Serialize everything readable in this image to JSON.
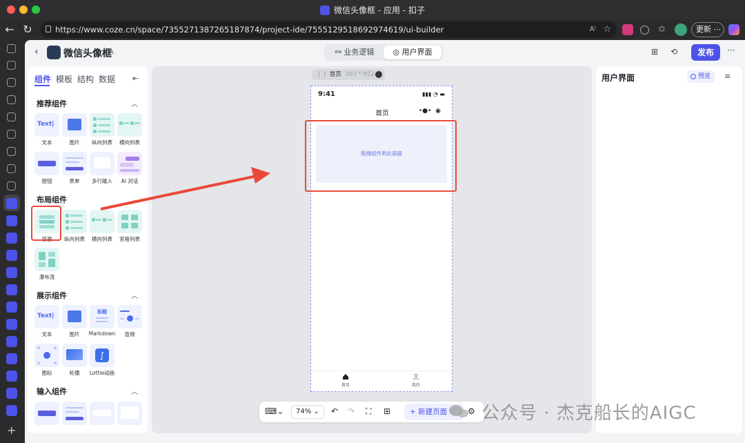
{
  "window": {
    "title": "微信头像框 - 应用 - 扣子"
  },
  "browser": {
    "url": "https://www.coze.cn/space/7355271387265187874/project-ide/7555129518692974619/ui-builder",
    "update_label": "更新"
  },
  "header": {
    "app_name": "微信头像框",
    "tabs": [
      {
        "label": "业务逻辑",
        "icon": "workflow-icon",
        "active": false
      },
      {
        "label": "用户界面",
        "icon": "palette-icon",
        "active": true
      }
    ],
    "publish_label": "发布"
  },
  "left_panel": {
    "tabs": [
      "组件",
      "模板",
      "结构",
      "数据"
    ],
    "active_tab": "组件",
    "sections": [
      {
        "title": "推荐组件",
        "items": [
          {
            "label": "文本",
            "tile_text": "Text|"
          },
          {
            "label": "图片"
          },
          {
            "label": "纵向列表"
          },
          {
            "label": "横向列表"
          },
          {
            "label": "按钮",
            "tile_text": "Button"
          },
          {
            "label": "表单"
          },
          {
            "label": "多行输入"
          },
          {
            "label": "AI 对话"
          }
        ]
      },
      {
        "title": "布局组件",
        "items": [
          {
            "label": "容器",
            "highlighted": true
          },
          {
            "label": "纵向列表"
          },
          {
            "label": "横向列表"
          },
          {
            "label": "宫格列表"
          },
          {
            "label": "瀑布流"
          }
        ]
      },
      {
        "title": "展示组件",
        "items": [
          {
            "label": "文本",
            "tile_text": "Text|"
          },
          {
            "label": "图片"
          },
          {
            "label": "Markdown",
            "tile_text": "标题"
          },
          {
            "label": "音频"
          },
          {
            "label": "图标"
          },
          {
            "label": "轮播"
          },
          {
            "label": "Lottie动画"
          }
        ]
      },
      {
        "title": "输入组件",
        "items": [
          {
            "label": "",
            "tile_text": "Button"
          },
          {
            "label": ""
          },
          {
            "label": ""
          },
          {
            "label": ""
          }
        ]
      }
    ]
  },
  "canvas": {
    "page_tag": "首页",
    "page_size": "393 * 852",
    "phone": {
      "time": "9:41",
      "title": "首页",
      "dropzone_text": "拖拽组件到此容器",
      "tabs": [
        {
          "label": "首页",
          "icon": "home-icon"
        },
        {
          "label": "我的",
          "icon": "user-icon"
        }
      ]
    }
  },
  "bottom_toolbar": {
    "zoom": "74%",
    "new_page_label": "新建页面"
  },
  "right_panel": {
    "title": "用户界面",
    "preview_label": "预览"
  },
  "watermark": {
    "text": "公众号 · 杰克船长的AIGC"
  },
  "colors": {
    "brand": "#4d53e8",
    "annotation_red": "#e84a3a",
    "dropzone_bg": "#eef0fb"
  }
}
